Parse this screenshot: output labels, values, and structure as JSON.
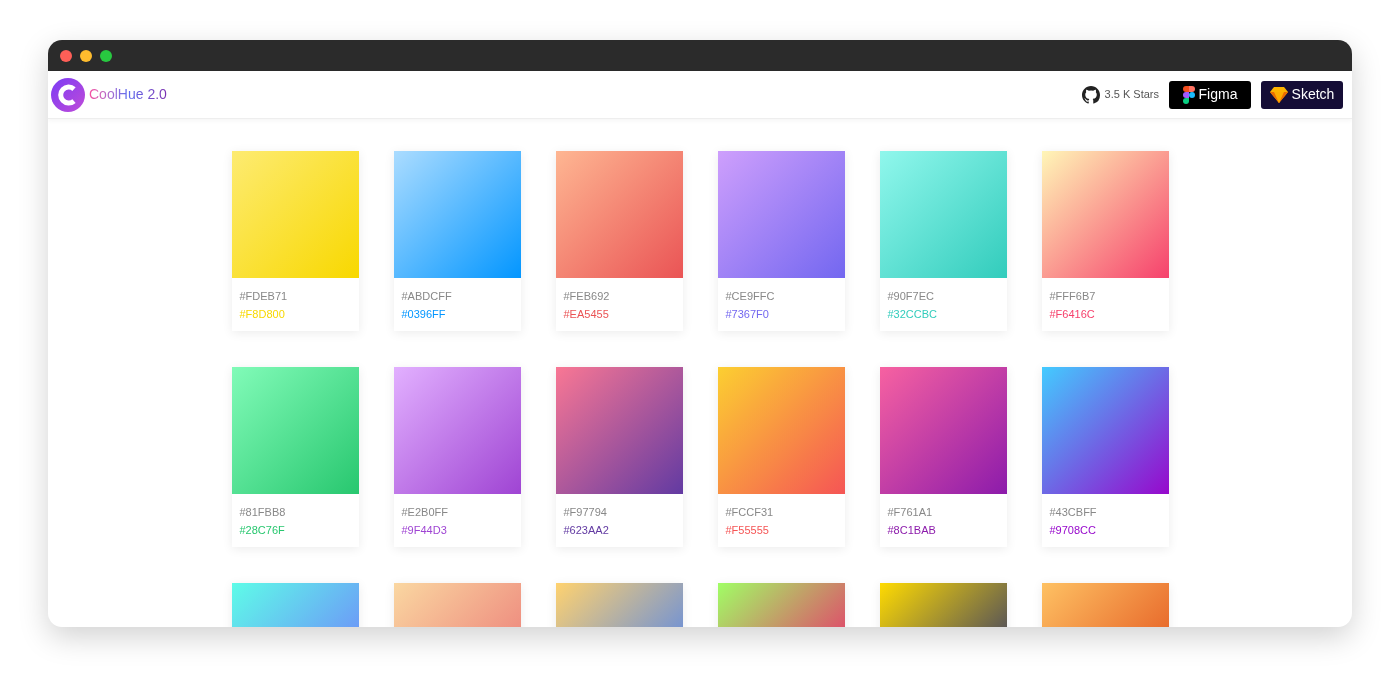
{
  "window": {
    "controls": [
      {
        "color": "#ff5f57"
      },
      {
        "color": "#febc2e"
      },
      {
        "color": "#28c840"
      }
    ]
  },
  "header": {
    "logo": {
      "name": "CoolHue",
      "version": "2.0"
    },
    "github": {
      "stars": "3.5 K Stars"
    },
    "buttons": [
      {
        "kind": "figma",
        "label": "Figma"
      },
      {
        "kind": "sketch",
        "label": "Sketch"
      }
    ]
  },
  "gradients": [
    {
      "start": "#FDEB71",
      "end": "#F8D800"
    },
    {
      "start": "#ABDCFF",
      "end": "#0396FF"
    },
    {
      "start": "#FEB692",
      "end": "#EA5455"
    },
    {
      "start": "#CE9FFC",
      "end": "#7367F0"
    },
    {
      "start": "#90F7EC",
      "end": "#32CCBC"
    },
    {
      "start": "#FFF6B7",
      "end": "#F6416C"
    },
    {
      "start": "#81FBB8",
      "end": "#28C76F"
    },
    {
      "start": "#E2B0FF",
      "end": "#9F44D3"
    },
    {
      "start": "#F97794",
      "end": "#623AA2"
    },
    {
      "start": "#FCCF31",
      "end": "#F55555"
    },
    {
      "start": "#F761A1",
      "end": "#8C1BAB"
    },
    {
      "start": "#43CBFF",
      "end": "#9708CC"
    }
  ]
}
